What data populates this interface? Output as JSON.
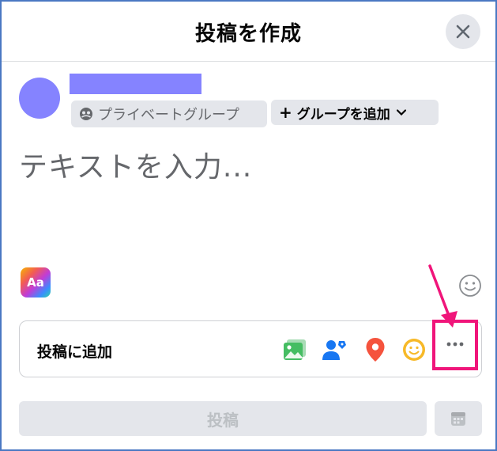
{
  "dialog": {
    "title": "投稿を作成"
  },
  "composer": {
    "privacy_label": "プライベートグループ",
    "add_group_label": "グループを追加",
    "text_placeholder": "テキストを入力..."
  },
  "background_picker": {
    "label": "Aa"
  },
  "add_to_post": {
    "label": "投稿に追加",
    "tools": [
      {
        "name": "photo-video",
        "icon": "photo-icon",
        "color": "#45bd62"
      },
      {
        "name": "tag-people",
        "icon": "tag-people-icon",
        "color": "#1877f2"
      },
      {
        "name": "check-in",
        "icon": "location-pin-icon",
        "color": "#f5533d"
      },
      {
        "name": "feeling",
        "icon": "smiley-icon",
        "color": "#f7b928"
      },
      {
        "name": "more",
        "icon": "more-dots-icon",
        "color": "#65676b"
      }
    ]
  },
  "footer": {
    "post_label": "投稿"
  },
  "colors": {
    "avatar": "#8583ff",
    "highlight": "#f0157a",
    "button_bg": "#e4e6eb"
  }
}
